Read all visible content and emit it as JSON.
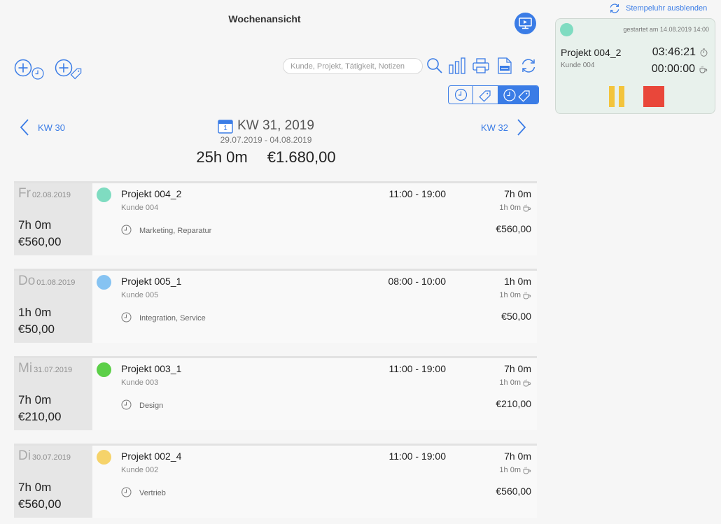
{
  "header": {
    "title": "Wochenansicht"
  },
  "toolbar": {
    "search_placeholder": "Kunde, Projekt, Tätigkeit, Notizen"
  },
  "week": {
    "prev": "KW 30",
    "next": "KW 32",
    "calendar_day": "1",
    "title": "KW 31, 2019",
    "range": "29.07.2019 - 04.08.2019",
    "total_hours": "25h 0m",
    "total_amount": "€1.680,00"
  },
  "stopwatch": {
    "hide_label": "Stempeluhr ausblenden",
    "started": "gestartet am 14.08.2019 14:00",
    "project": "Projekt 004_2",
    "customer": "Kunde 004",
    "elapsed": "03:46:21",
    "pause": "00:00:00"
  },
  "days": [
    {
      "name": "Fr",
      "date": "02.08.2019",
      "hours": "7h 0m",
      "amount": "€560,00",
      "color": "#7fdcc1",
      "entry": {
        "project": "Projekt 004_2",
        "customer": "Kunde 004",
        "tags": "Marketing, Reparatur",
        "time": "11:00 - 19:00",
        "duration": "7h 0m",
        "break": "1h 0m",
        "amount": "€560,00"
      }
    },
    {
      "name": "Do",
      "date": "01.08.2019",
      "hours": "1h 0m",
      "amount": "€50,00",
      "color": "#86c3f2",
      "entry": {
        "project": "Projekt 005_1",
        "customer": "Kunde 005",
        "tags": "Integration, Service",
        "time": "08:00 - 10:00",
        "duration": "1h 0m",
        "break": "1h 0m",
        "amount": "€50,00"
      }
    },
    {
      "name": "Mi",
      "date": "31.07.2019",
      "hours": "7h 0m",
      "amount": "€210,00",
      "color": "#5ccf48",
      "entry": {
        "project": "Projekt 003_1",
        "customer": "Kunde 003",
        "tags": "Design",
        "time": "11:00 - 19:00",
        "duration": "7h 0m",
        "break": "1h 0m",
        "amount": "€210,00"
      }
    },
    {
      "name": "Di",
      "date": "30.07.2019",
      "hours": "7h 0m",
      "amount": "€560,00",
      "color": "#f6d36a",
      "entry": {
        "project": "Projekt 002_4",
        "customer": "Kunde 002",
        "tags": "Vertrieb",
        "time": "11:00 - 19:00",
        "duration": "7h 0m",
        "break": "1h 0m",
        "amount": "€560,00"
      }
    }
  ]
}
